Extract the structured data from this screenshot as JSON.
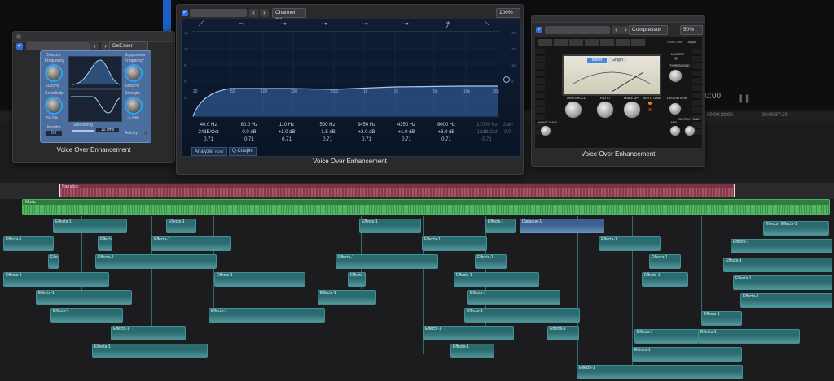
{
  "colors": {
    "accent": "#2f6fd6",
    "clip": "#2a6b70",
    "narration": "#a04a5c",
    "music": "#3ea24f",
    "dialogue": "#4a6aa0"
  },
  "timeline": {
    "timecode": "00:00",
    "ruler_ticks": [
      "00:00:20:00",
      "00:00:37:20"
    ]
  },
  "deesser": {
    "plugin": "DeEsser",
    "detector_label": "Detector",
    "suppressor_label": "Suppressor",
    "freq_label_l": "Frequency",
    "freq_value_l": "6000Hz",
    "freq_label_r": "Frequency",
    "freq_value_r": "6000Hz",
    "sens_label": "Sensitivity",
    "sens_value": "50.0%",
    "strength_label": "Strength",
    "strength_value": "-6.0dB",
    "monitor_label": "Monitor",
    "monitor_value": "Off",
    "smoothing_label": "Smoothing",
    "smoothing_value": "10.0ms",
    "activity_label": "Activity",
    "footer": "Voice Over Enhancement"
  },
  "eq": {
    "plugin": "Channel EQ",
    "zoom": "100%",
    "freq_axis": [
      "20",
      "50",
      "100",
      "200",
      "500",
      "1k",
      "2k",
      "5k",
      "10k",
      "20k"
    ],
    "bands": [
      {
        "freq": "40.0 Hz",
        "gain": "24dB/Oct",
        "q": "0.71"
      },
      {
        "freq": "80.0 Hz",
        "gain": "0.0 dB",
        "q": "0.71"
      },
      {
        "freq": "110 Hz",
        "gain": "+1.0 dB",
        "q": "0.71"
      },
      {
        "freq": "500 Hz",
        "gain": "-1.5 dB",
        "q": "0.71"
      },
      {
        "freq": "3450 Hz",
        "gain": "+2.0 dB",
        "q": "0.71"
      },
      {
        "freq": "4350 Hz",
        "gain": "+1.0 dB",
        "q": "0.71"
      },
      {
        "freq": "9000 Hz",
        "gain": "+3.0 dB",
        "q": "0.71"
      },
      {
        "freq": "17000 Hz",
        "gain": "12dB/Oct",
        "q": "0.71"
      }
    ],
    "gain_label": "Gain",
    "gain_value": "0.0",
    "analyzer_label": "Analyzer",
    "analyzer_mode": "POST",
    "qcouple_label": "Q-Couple",
    "footer": "Voice Over Enhancement"
  },
  "compressor": {
    "plugin": "Compressor",
    "zoom": "50%",
    "meter_tab": "Meter",
    "graph_tab": "Graph",
    "limiter_label": "LIMITER",
    "threshold_l": "THRESHOLD",
    "threshold_label": "THRESHOLD",
    "ratio_label": "RATIO",
    "makeup_label": "MAKE UP",
    "autogain_label": "AUTO GAIN",
    "distortion_label": "DISTORTION",
    "mix_label": "MIX",
    "input_gain_label": "INPUT GAIN",
    "output_gain_label": "OUTPUT GAIN",
    "side_chain": "Side Chain",
    "output": "Output",
    "footer": "Voice Over Enhancement"
  },
  "tracks": {
    "narration": "Narration",
    "music": "Music",
    "dialogue": "Dialogue-1",
    "effect_label": "Effects-1"
  }
}
